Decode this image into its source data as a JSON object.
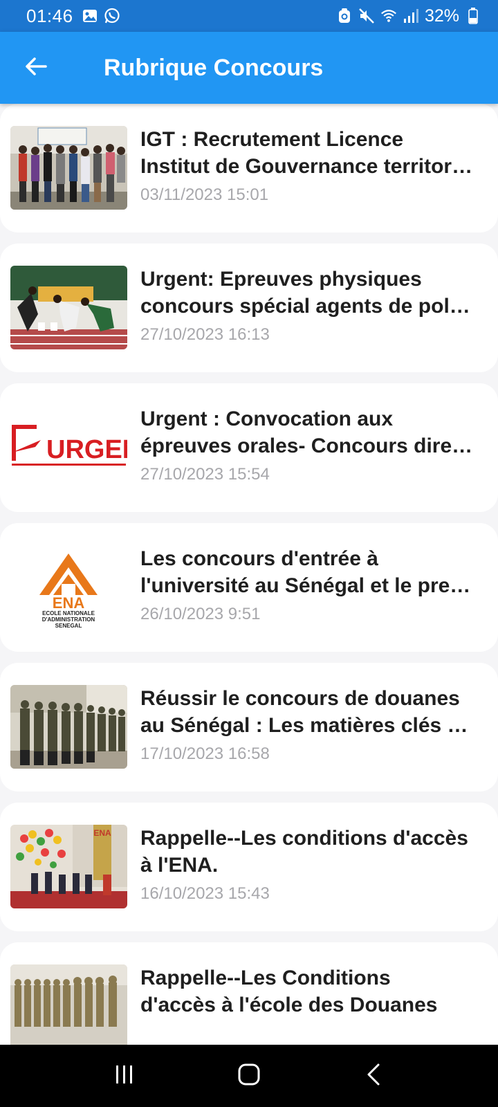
{
  "status_bar": {
    "time": "01:46",
    "battery": "32%",
    "left_icons": [
      "gallery-icon",
      "whatsapp-icon"
    ],
    "right_icons": [
      "nfc-icon",
      "mute-icon",
      "wifi-icon",
      "signal-icon",
      "battery-icon"
    ]
  },
  "app_bar": {
    "title": "Rubrique Concours",
    "back_icon": "arrow-left-icon",
    "color": "#2196f3"
  },
  "articles": [
    {
      "title_line1": "IGT : Recrutement Licence",
      "title_line2": "Institut de Gouvernance territor…",
      "date": "03/11/2023 15:01",
      "thumb": "group-photo"
    },
    {
      "title_line1": "Urgent: Epreuves physiques",
      "title_line2": "concours spécial agents de pol…",
      "date": "27/10/2023 16:13",
      "thumb": "runners-photo"
    },
    {
      "title_line1": "Urgent : Convocation aux",
      "title_line2": "épreuves orales- Concours dire…",
      "date": "27/10/2023 15:54",
      "thumb": "urgent-logo",
      "thumb_text": "URGENT"
    },
    {
      "title_line1": "Les concours d'entrée à",
      "title_line2": "l'université au Sénégal et le pre…",
      "date": "26/10/2023 9:51",
      "thumb": "ena-logo",
      "thumb_text": "ENA",
      "thumb_sub": [
        "ECOLE NATIONALE",
        "D'ADMINISTRATION",
        "SENEGAL"
      ]
    },
    {
      "title_line1": "Réussir le concours de douanes",
      "title_line2": "au Sénégal : Les matières clés …",
      "date": "17/10/2023 16:58",
      "thumb": "soldiers-photo"
    },
    {
      "title_line1": "Rappelle--Les conditions d'accès",
      "title_line2": "à l'ENA.",
      "date": "16/10/2023 15:43",
      "thumb": "ceremony-photo"
    },
    {
      "title_line1": "Rappelle--Les Conditions",
      "title_line2": "d'accès à l'école des Douanes",
      "date": "",
      "thumb": "parade-photo"
    }
  ],
  "nav_bar": {
    "recent_icon": "recent-apps-icon",
    "home_icon": "home-icon",
    "back_icon": "back-icon"
  }
}
